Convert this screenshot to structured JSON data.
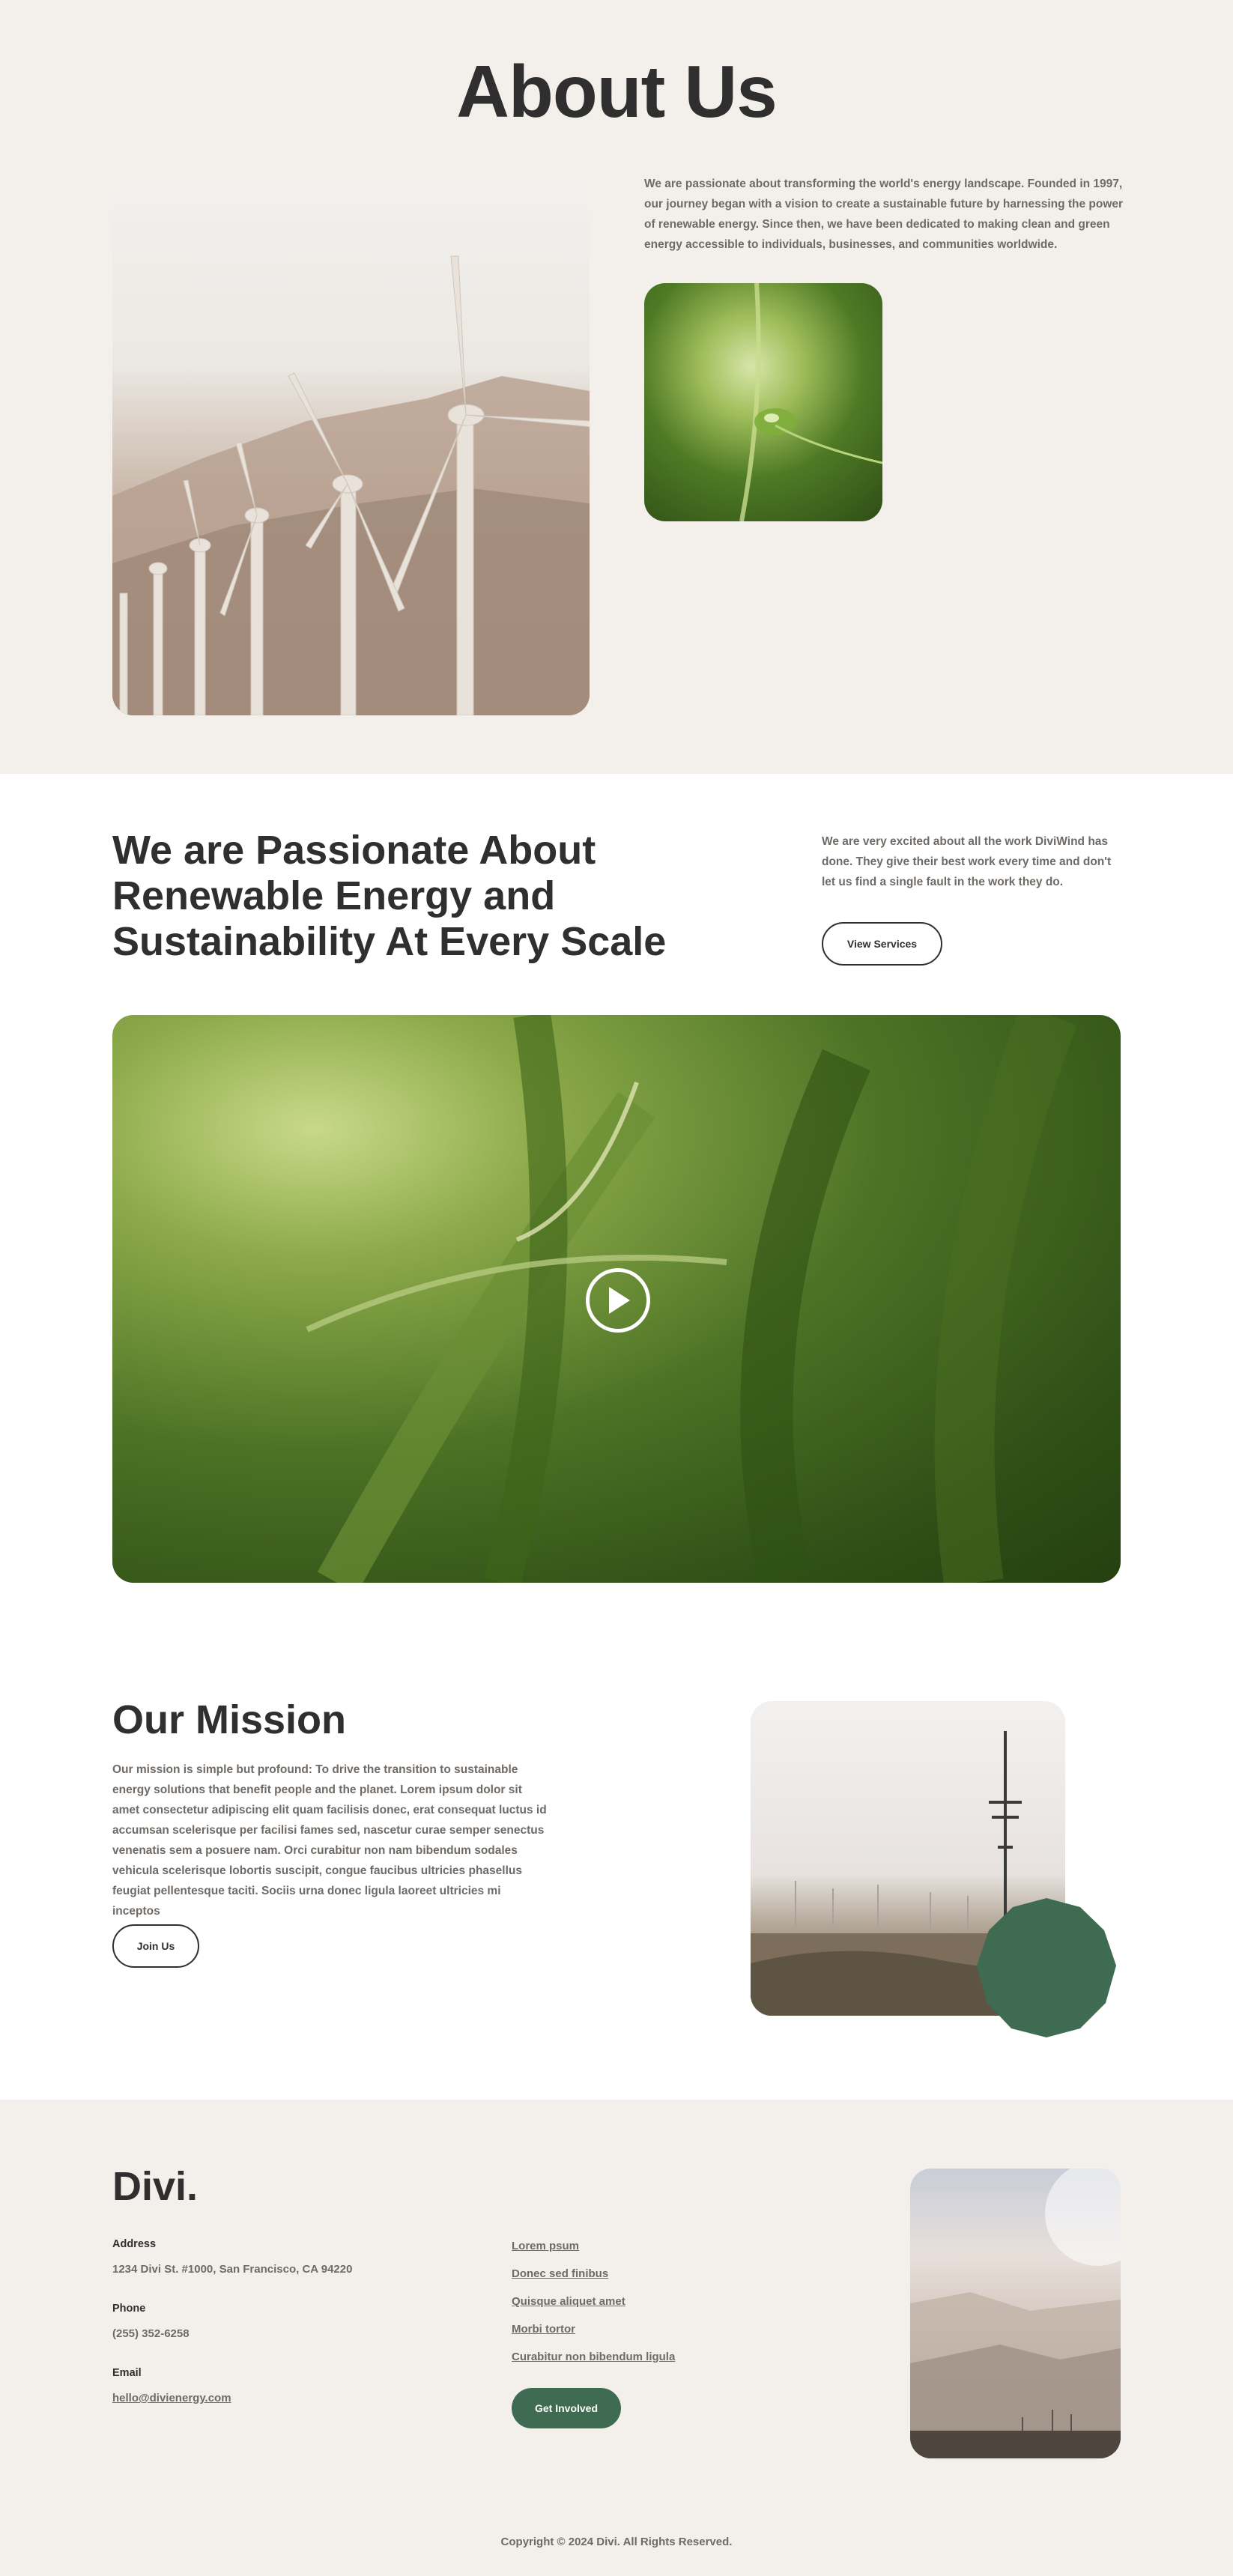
{
  "about": {
    "heading": "About Us",
    "paragraph": "We are passionate about transforming the world's energy landscape. Founded in 1997, our journey began with a vision to create a sustainable future by harnessing the power of renewable energy. Since then, we have been dedicated to making clean and green energy accessible to individuals, businesses, and communities worldwide."
  },
  "passion": {
    "heading": "We are Passionate About Renewable Energy and Sustainability At Every Scale",
    "paragraph": "We are very excited about all the work DiviWind has done. They give their best work every time and don't let us find a single fault in the work they do.",
    "button_label": "View Services"
  },
  "mission": {
    "heading": "Our Mission",
    "paragraph": "Our mission is simple but profound: To drive the transition to sustainable energy solutions that benefit people and the planet. Lorem ipsum dolor sit amet consectetur adipiscing elit quam facilisis donec, erat consequat luctus id accumsan scelerisque per facilisi fames sed, nascetur curae semper senectus venenatis sem a posuere nam. Orci curabitur non nam bibendum sodales vehicula scelerisque lobortis suscipit, congue faucibus ultricies phasellus feugiat pellentesque taciti. Sociis urna donec ligula laoreet ultricies mi inceptos",
    "button_label": "Join Us"
  },
  "footer": {
    "logo": "Divi.",
    "address_label": "Address",
    "address_value": "1234 Divi St. #1000, San Francisco, CA 94220",
    "phone_label": "Phone",
    "phone_value": "(255) 352-6258",
    "email_label": "Email",
    "email_value": "hello@divienergy.com",
    "links": [
      "Lorem psum",
      "Donec sed finibus",
      "Quisque aliquet amet",
      "Morbi tortor",
      "Curabitur non bibendum ligula"
    ],
    "cta_label": "Get Involved",
    "copyright": "Copyright © 2024 Divi. All Rights Reserved."
  },
  "colors": {
    "beige_bg": "#f3efea",
    "text_dark": "#2f2f2f",
    "text_muted": "#6f6a66",
    "accent_green": "#3f6b52"
  }
}
